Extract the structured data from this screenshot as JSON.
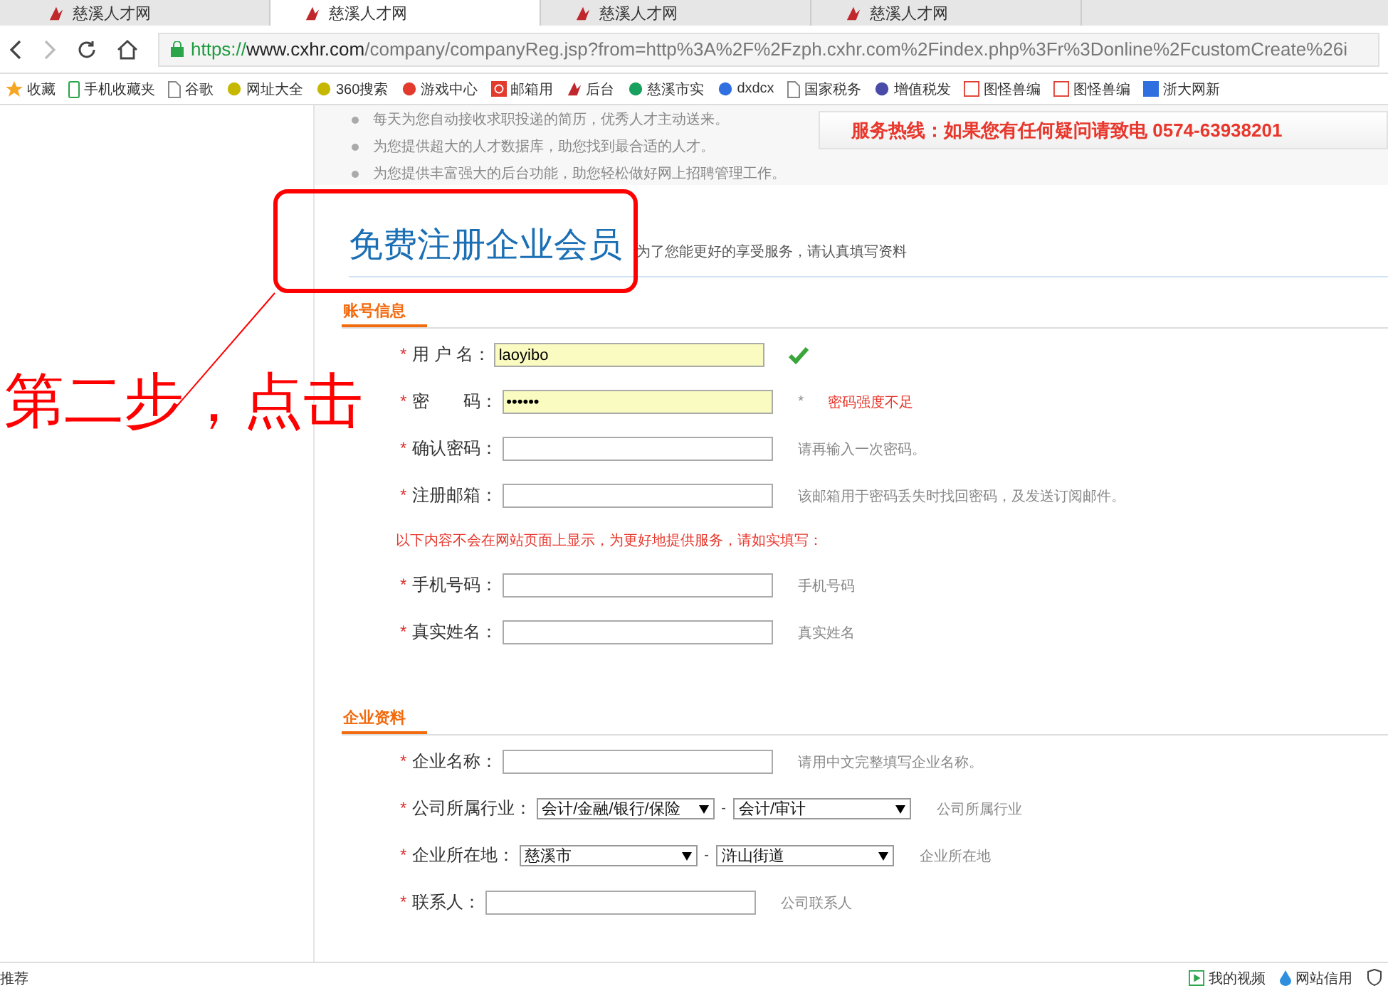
{
  "browser": {
    "tabs": [
      {
        "title": "慈溪人才网",
        "selected": false
      },
      {
        "title": "慈溪人才网",
        "selected": true
      },
      {
        "title": "慈溪人才网",
        "selected": false
      },
      {
        "title": "慈溪人才网",
        "selected": false
      }
    ],
    "url": {
      "scheme": "https://",
      "host": "www.cxhr.com",
      "path": "/company/companyReg.jsp?from=http%3A%2F%2Fzph.cxhr.com%2Findex.php%3Fr%3Donline%2FcustomCreate%26i"
    },
    "bookmarks": [
      {
        "label": "收藏",
        "kind": "star"
      },
      {
        "label": "手机收藏夹",
        "kind": "phone"
      },
      {
        "label": "谷歌",
        "kind": "page"
      },
      {
        "label": "网址大全",
        "kind": "plus"
      },
      {
        "label": "360搜索",
        "kind": "plus"
      },
      {
        "label": "游戏中心",
        "kind": "game"
      },
      {
        "label": "邮箱用",
        "kind": "mail"
      },
      {
        "label": "后台",
        "kind": "logo"
      },
      {
        "label": "慈溪市实",
        "kind": "c"
      },
      {
        "label": "dxdcx",
        "kind": "paw"
      },
      {
        "label": "国家税务",
        "kind": "page"
      },
      {
        "label": "增值税发",
        "kind": "circle"
      },
      {
        "label": "图怪兽编",
        "kind": "square"
      },
      {
        "label": "图怪兽编",
        "kind": "square"
      },
      {
        "label": "浙大网新",
        "kind": "blue"
      }
    ]
  },
  "intro": {
    "bullets": [
      "每天为您自动接收求职投递的简历，优秀人才主动送来。",
      "为您提供超大的人才数据库，助您找到最合适的人才。",
      "为您提供丰富强大的后台功能，助您轻松做好网上招聘管理工作。"
    ],
    "hotline": "服务热线：如果您有任何疑问请致电  0574-63938201"
  },
  "title": "免费注册企业会员",
  "subtitle": "为了您能更好的享受服务，请认真填写资料",
  "sections": [
    {
      "heading": "账号信息",
      "fields": [
        {
          "label": "用 户 名：",
          "kind": "text",
          "value": "laoyibo",
          "autofilled": true,
          "valid": true
        },
        {
          "label": "密　　码：",
          "kind": "password",
          "value": "••••••",
          "autofilled": true,
          "hint": "*",
          "warning": "密码强度不足"
        },
        {
          "label": "确认密码：",
          "kind": "text",
          "hint": "请再输入一次密码。"
        },
        {
          "label": "注册邮箱：",
          "kind": "text",
          "hint": "该邮箱用于密码丢失时找回密码，及发送订阅邮件。"
        },
        {
          "kind": "notice",
          "text": "以下内容不会在网站页面上显示，为更好地提供服务，请如实填写："
        },
        {
          "label": "手机号码：",
          "kind": "text",
          "hint": "手机号码"
        },
        {
          "label": "真实姓名：",
          "kind": "text",
          "hint": "真实姓名"
        }
      ]
    },
    {
      "heading": "企业资料",
      "fields": [
        {
          "label": "企业名称：",
          "kind": "text",
          "hint": "请用中文完整填写企业名称。"
        },
        {
          "label": "公司所属行业：",
          "kind": "select",
          "options": [
            "会计/金融/银行/保险",
            "会计/审计"
          ],
          "separator": "-",
          "hint": "公司所属行业"
        },
        {
          "label": "企业所在地：",
          "kind": "select",
          "options": [
            "慈溪市",
            "浒山街道"
          ],
          "separator": "-",
          "hint": "企业所在地"
        },
        {
          "label": "联系人：",
          "kind": "text",
          "hint": "公司联系人"
        }
      ]
    }
  ],
  "annotation": {
    "text": "第二步，点击"
  },
  "status_bar": {
    "left": "推荐",
    "items": [
      "我的视频",
      "网站信用"
    ]
  }
}
